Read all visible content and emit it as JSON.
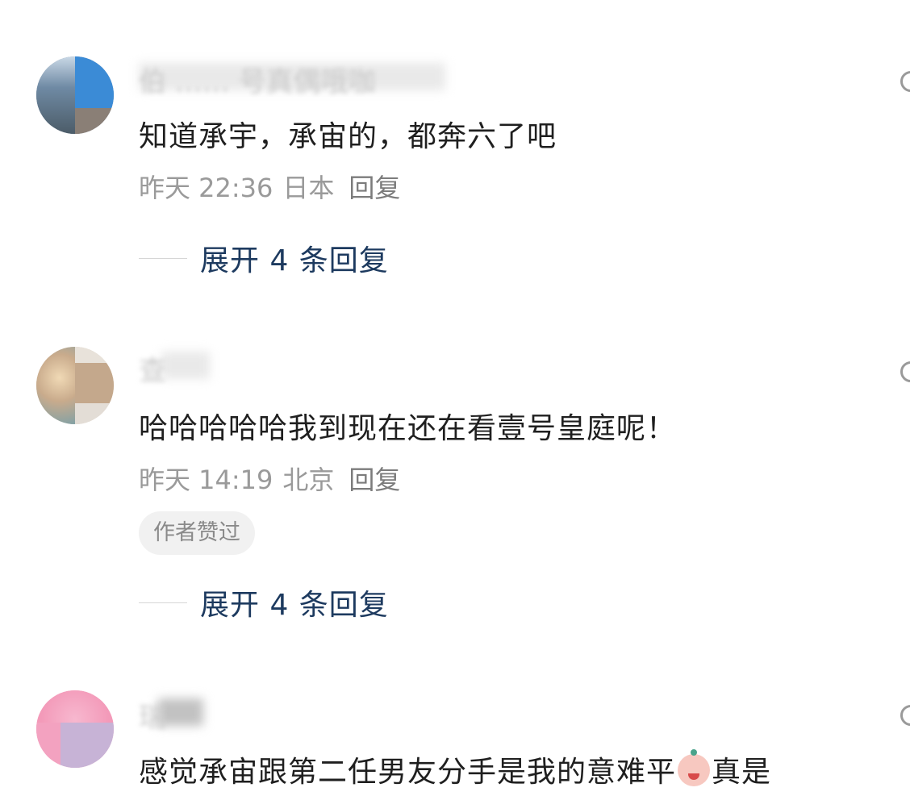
{
  "comments": [
    {
      "username": "伯 …… 号真偶哦咖",
      "text": "知道承宇，承宙的，都奔六了吧",
      "time": "昨天 22:36",
      "location": "日本",
      "reply_label": "回复",
      "expand_label": "展开 4 条回复",
      "avatar_colors": [
        "#5b7a98",
        "#3b8bd6",
        "#8a7f76"
      ]
    },
    {
      "username": "查",
      "text": "哈哈哈哈哈我到现在还在看壹号皇庭呢！",
      "time": "昨天 14:19",
      "location": "北京",
      "reply_label": "回复",
      "badge": "作者赞过",
      "expand_label": "展开 4 条回复",
      "avatar_colors": [
        "#d9cbb9",
        "#c9ab8c",
        "#7aa0a8"
      ]
    },
    {
      "username": "瑞",
      "text_before_emoji": "感觉承宙跟第二任男友分手是我的意难平",
      "emoji": "crying-face-icon",
      "text_after_emoji": "真是",
      "avatar_colors": [
        "#f4a7c1",
        "#c7b3d6"
      ]
    }
  ]
}
